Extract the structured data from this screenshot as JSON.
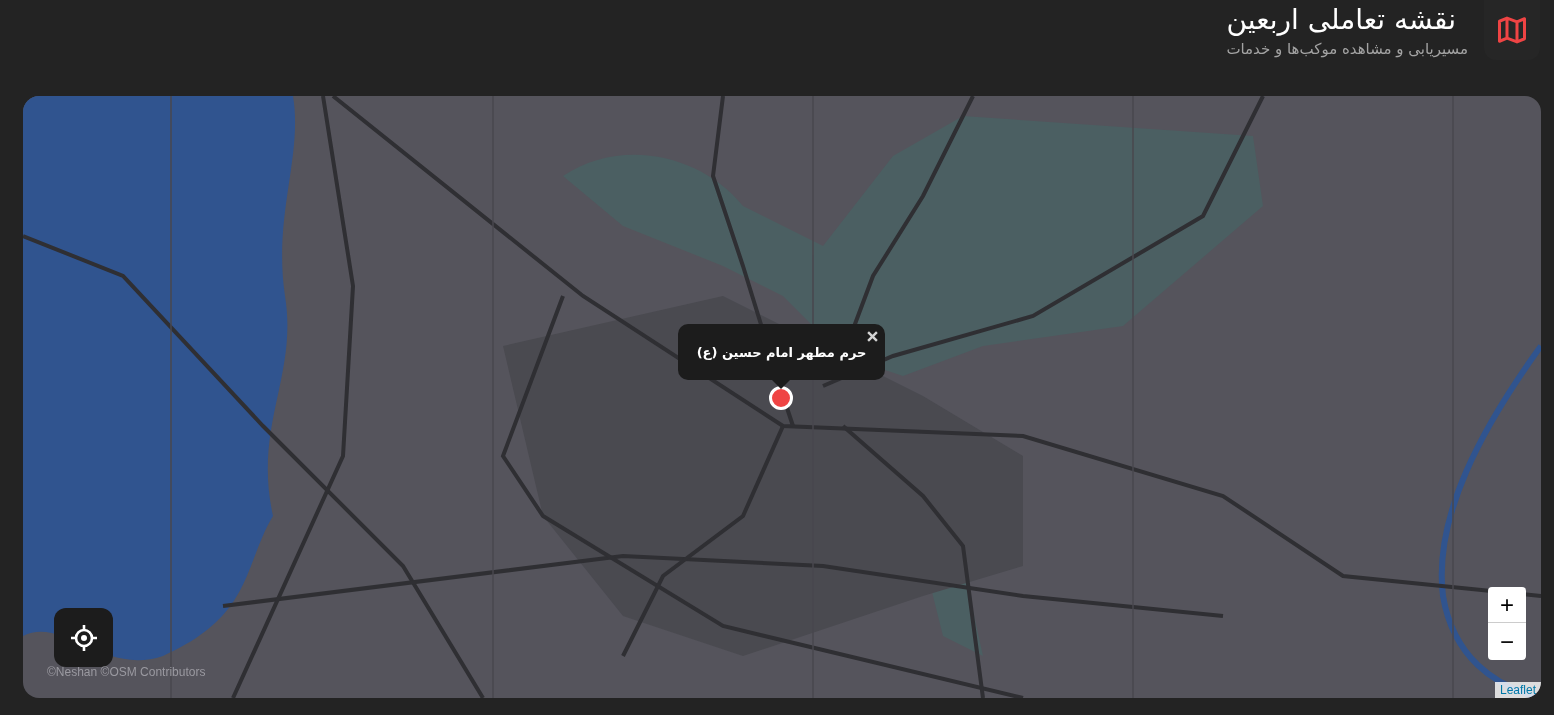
{
  "header": {
    "title": "نقشه تعاملی اربعین",
    "subtitle": "مسیریابی و مشاهده موکب‌ها و خدمات"
  },
  "map": {
    "popup": {
      "title": "حرم مطهر امام حسین (ع)"
    },
    "zoom_controls": [
      "+",
      "−"
    ],
    "attribution": "©Neshan ©OSM Contributors",
    "leaflet_link": "Leaflet"
  }
}
